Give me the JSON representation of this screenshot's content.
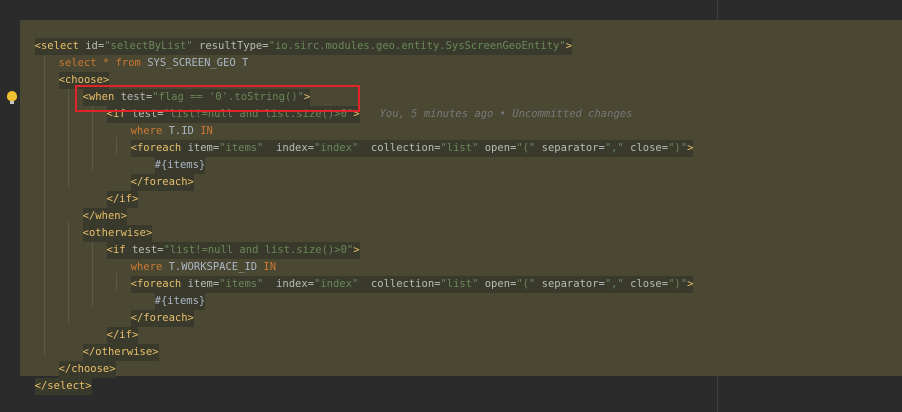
{
  "code": {
    "line1": {
      "open": "<select ",
      "id_attr": "id=",
      "id_val": "\"selectByList\"",
      "rt_attr": " resultType=",
      "rt_val": "\"io.sirc.modules.geo.entity.SysScreenGeoEntity\"",
      "close": ">"
    },
    "line2": {
      "kw_select": "select ",
      "star": "* ",
      "kw_from": "from ",
      "table": "SYS_SCREEN_GEO T"
    },
    "line3": {
      "tag": "<choose>"
    },
    "line4": {
      "open": "<when ",
      "attr": "test=",
      "val": "\"flag == '0'.toString()\"",
      "close": ">"
    },
    "line5": {
      "open": "<if ",
      "attr": "test=",
      "val": "\"list!=null and list.size()>0\"",
      "close": ">",
      "blame": "You, 5 minutes ago • Uncommitted changes"
    },
    "line6": {
      "kw": "where ",
      "col": "T.ID ",
      "kw_in": "IN"
    },
    "line7": {
      "open": "<foreach ",
      "item_attr": "item=",
      "item_val": "\"items\"",
      "index_attr": "  index=",
      "index_val": "\"index\"",
      "coll_attr": "  collection=",
      "coll_val": "\"list\"",
      "open_attr": " open=",
      "open_val": "\"(\"",
      "sep_attr": " separator=",
      "sep_val": "\",\"",
      "close_attr": " close=",
      "close_val": "\")\"",
      "close": ">"
    },
    "line8": {
      "text": "#{items}"
    },
    "line9": {
      "tag": "</foreach>"
    },
    "line10": {
      "tag": "</if>"
    },
    "line11": {
      "tag": "</when>"
    },
    "line12": {
      "tag": "<otherwise>"
    },
    "line13": {
      "open": "<if ",
      "attr": "test=",
      "val": "\"list!=null and list.size()>0\"",
      "close": ">"
    },
    "line14": {
      "kw": "where ",
      "col": "T.WORKSPACE_ID ",
      "kw_in": "IN"
    },
    "line15": {
      "open": "<foreach ",
      "item_attr": "item=",
      "item_val": "\"items\"",
      "index_attr": "  index=",
      "index_val": "\"index\"",
      "coll_attr": "  collection=",
      "coll_val": "\"list\"",
      "open_attr": " open=",
      "open_val": "\"(\"",
      "sep_attr": " separator=",
      "sep_val": "\",\"",
      "close_attr": " close=",
      "close_val": "\")\"",
      "close": ">"
    },
    "line16": {
      "text": "#{items}"
    },
    "line17": {
      "tag": "</foreach>"
    },
    "line18": {
      "tag": "</if>"
    },
    "line19": {
      "tag": "</otherwise>"
    },
    "line20": {
      "tag": "</choose>"
    },
    "line21": {
      "tag": "</select>"
    }
  },
  "icons": {
    "gutter_bulb": "lightbulb-icon"
  },
  "colors": {
    "background": "#2b2b2b",
    "fragment_bg": "#4a4833",
    "tag": "#e8bf6a",
    "attribute": "#bababa",
    "string": "#6a8759",
    "keyword": "#cc7832",
    "highlight_box": "#e0242a"
  }
}
